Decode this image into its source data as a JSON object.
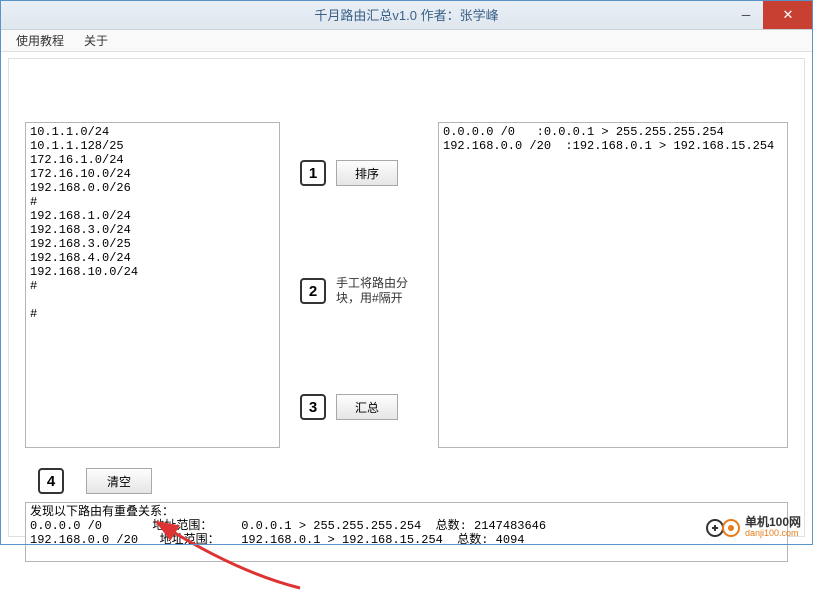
{
  "window": {
    "title": "千月路由汇总v1.0   作者：张学峰"
  },
  "menu": {
    "tutorial": "使用教程",
    "about": "关于"
  },
  "left_input": "10.1.1.0/24\n10.1.1.128/25\n172.16.1.0/24\n172.16.10.0/24\n192.168.0.0/26\n#\n192.168.1.0/24\n192.168.3.0/24\n192.168.3.0/25\n192.168.4.0/24\n192.168.10.0/24\n#\n\n#",
  "right_output": "0.0.0.0 /0   :0.0.0.1 > 255.255.255.254\n192.168.0.0 /20  :192.168.0.1 > 192.168.15.254",
  "steps": {
    "n1": "1",
    "n2": "2",
    "n3": "3",
    "n4": "4",
    "sort_label": "排序",
    "step2_text": "手工将路由分\n块，用#隔开",
    "summary_label": "汇总",
    "clear_label": "清空"
  },
  "bottom_log": "发现以下路由有重叠关系：\n0.0.0.0 /0       地址范围：    0.0.0.1 > 255.255.255.254  总数: 2147483646\n192.168.0.0 /20   地址范围：   192.168.0.1 > 192.168.15.254  总数: 4094",
  "watermark": {
    "line1": "单机100网",
    "line2": "danji100.com"
  }
}
